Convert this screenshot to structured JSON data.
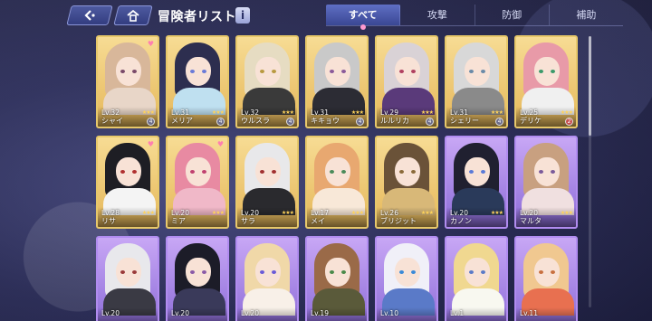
{
  "header": {
    "title": "冒険者リスト",
    "info_label": "i"
  },
  "tabs": [
    {
      "label": "すべて",
      "active": true
    },
    {
      "label": "攻撃",
      "active": false
    },
    {
      "label": "防御",
      "active": false
    },
    {
      "label": "補助",
      "active": false
    }
  ],
  "colors": {
    "gold_frame": "#e7c86a",
    "purple_frame": "#b18cf0",
    "tab_active": "#4a58a8"
  },
  "adventurers": [
    {
      "lv": "Lv.32",
      "name": "シャイ",
      "stars": "★★★",
      "frame": "gold",
      "hair": "#d8b79a",
      "outfit": "#e8d6c8",
      "eye": "#7a4a6a",
      "badge": "4",
      "heart": true
    },
    {
      "lv": "Lv.31",
      "name": "メリア",
      "stars": "★★★",
      "frame": "gold",
      "hair": "#2d2e4f",
      "outfit": "#bfe0f0",
      "eye": "#6a7ad8",
      "badge": "4",
      "heart": false
    },
    {
      "lv": "Lv.32",
      "name": "ウルスラ",
      "stars": "★★★",
      "frame": "gold",
      "hair": "#e6dcc2",
      "outfit": "#3a3a3a",
      "eye": "#b89a40",
      "badge": "4",
      "heart": false
    },
    {
      "lv": "Lv.31",
      "name": "キキョウ",
      "stars": "★★★",
      "frame": "gold",
      "hair": "#c9c9c9",
      "outfit": "#2c2c34",
      "eye": "#8a5a9a",
      "badge": "4",
      "heart": false
    },
    {
      "lv": "Lv.29",
      "name": "ルルリカ",
      "stars": "★★★",
      "frame": "gold",
      "hair": "#d9d2d6",
      "outfit": "#5a3a7a",
      "eye": "#b04060",
      "badge": "4",
      "heart": false
    },
    {
      "lv": "Lv.31",
      "name": "シェリー",
      "stars": "★★★",
      "frame": "gold",
      "hair": "#d8d8d8",
      "outfit": "#8a8a8a",
      "eye": "#6a8aa8",
      "badge": "4",
      "heart": false
    },
    {
      "lv": "Lv.25",
      "name": "デリケ",
      "stars": "★★★",
      "frame": "gold",
      "hair": "#e89aa8",
      "outfit": "#f0f0f0",
      "eye": "#3a9a6a",
      "badge": "2",
      "heart": false
    },
    {
      "lv": "Lv.28",
      "name": "リサ",
      "stars": "★★★",
      "frame": "gold",
      "hair": "#1e1e24",
      "outfit": "#f4f4f4",
      "eye": "#b03030",
      "badge": "",
      "heart": true
    },
    {
      "lv": "Lv.20",
      "name": "ミア",
      "stars": "★★★",
      "frame": "gold",
      "hair": "#e88aa2",
      "outfit": "#f0b8c8",
      "eye": "#c04070",
      "badge": "",
      "heart": true
    },
    {
      "lv": "Lv.20",
      "name": "サラ",
      "stars": "★★★",
      "frame": "gold",
      "hair": "#e8e8ea",
      "outfit": "#2a2a2e",
      "eye": "#a03030",
      "badge": "",
      "heart": false
    },
    {
      "lv": "Lv.17",
      "name": "メイ",
      "stars": "★★★",
      "frame": "gold",
      "hair": "#e8a870",
      "outfit": "#f8e8d8",
      "eye": "#4a8a5a",
      "badge": "",
      "heart": false
    },
    {
      "lv": "Lv.26",
      "name": "ブリジット",
      "stars": "★★★",
      "frame": "gold",
      "hair": "#6a5238",
      "outfit": "#d8b878",
      "eye": "#8a6a3a",
      "badge": "",
      "heart": false
    },
    {
      "lv": "Lv.20",
      "name": "カノン",
      "stars": "★★★",
      "frame": "purple",
      "hair": "#202030",
      "outfit": "#2a3a5a",
      "eye": "#5a7ad8",
      "badge": "",
      "heart": false
    },
    {
      "lv": "Lv.20",
      "name": "マルタ",
      "stars": "★★★",
      "frame": "purple",
      "hair": "#c8a080",
      "outfit": "#f0e0e0",
      "eye": "#7a5a9a",
      "badge": "",
      "heart": false
    },
    {
      "lv": "Lv.20",
      "name": "",
      "stars": "",
      "frame": "purple",
      "hair": "#e8e8ec",
      "outfit": "#3a3a44",
      "eye": "#9a3a3a",
      "badge": "",
      "heart": false
    },
    {
      "lv": "Lv.20",
      "name": "",
      "stars": "",
      "frame": "purple",
      "hair": "#1c1c28",
      "outfit": "#3a3a5a",
      "eye": "#8a5aa8",
      "badge": "",
      "heart": false
    },
    {
      "lv": "Lv.20",
      "name": "",
      "stars": "",
      "frame": "purple",
      "hair": "#f0d8a8",
      "outfit": "#f8f0e8",
      "eye": "#6a5ad8",
      "badge": "",
      "heart": false
    },
    {
      "lv": "Lv.19",
      "name": "",
      "stars": "",
      "frame": "purple",
      "hair": "#9a6a48",
      "outfit": "#5a5a3a",
      "eye": "#4a8a4a",
      "badge": "",
      "heart": false
    },
    {
      "lv": "Lv.10",
      "name": "",
      "stars": "",
      "frame": "purple",
      "hair": "#f0f0f8",
      "outfit": "#5a7ac8",
      "eye": "#3a8ad8",
      "badge": "",
      "heart": false
    },
    {
      "lv": "Lv.1",
      "name": "",
      "stars": "",
      "frame": "purple",
      "hair": "#f0d890",
      "outfit": "#f8f8f0",
      "eye": "#5a7ac8",
      "badge": "",
      "heart": false
    },
    {
      "lv": "Lv.11",
      "name": "",
      "stars": "",
      "frame": "purple",
      "hair": "#f0c890",
      "outfit": "#e87050",
      "eye": "#c87040",
      "badge": "",
      "heart": false
    }
  ]
}
